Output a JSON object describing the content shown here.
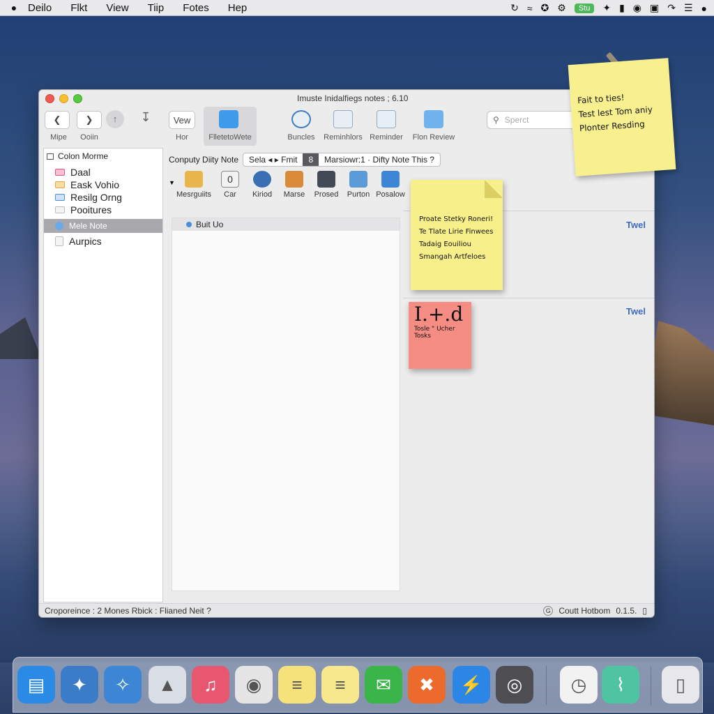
{
  "menubar": {
    "items": [
      "Deilo",
      "Flkt",
      "View",
      "Tiip",
      "Fotes",
      "Hep"
    ],
    "status_badge": "Stu",
    "status_icons": [
      "sync-icon",
      "wifi-icon",
      "satellite-icon",
      "gear-icon",
      "badge",
      "bluetooth-icon",
      "battery-icon",
      "settings-icon",
      "airplay-icon",
      "dnd-icon",
      "list-icon",
      "user-icon"
    ]
  },
  "window": {
    "title": "Imuste Inidalfiegs notes ; 6.10",
    "toolbar": {
      "back_label": "Mipe",
      "forward_label": "Ooiin",
      "view_button": "Vew",
      "view_label": "Hor",
      "file_label": "FlletetoWete",
      "bundles_label": "Buncles",
      "reminders_label": "Reminhlors",
      "reminder_label": "Reminder",
      "review_label": "Flon Review",
      "search_placeholder": "Sperct"
    },
    "sidebar": {
      "header": "Colon Morme",
      "items": [
        {
          "label": "Daal",
          "color": "#e04f7f"
        },
        {
          "label": "Eask Vohio",
          "color": "#e2a63a"
        },
        {
          "label": "Resilg Orng",
          "color": "#4c8fd9"
        },
        {
          "label": "Pooitures",
          "color": "#cccccc"
        },
        {
          "label": "Mele Note",
          "color": "#4c8fd9"
        },
        {
          "label": "Aurpics",
          "color": "#cccccc"
        }
      ]
    },
    "content": {
      "breadcrumb": "Conputy Diity Note",
      "segments": [
        "Sela ◂ ▸ Fmit",
        "8",
        "Marsiowr:1 · Difty Note This ?"
      ],
      "icons": [
        {
          "label": "Mesrguiits",
          "color": "#e8b64a"
        },
        {
          "label": "Car",
          "color": "#f2f2f2"
        },
        {
          "label": "Kiriod",
          "color": "#3a6fb3"
        },
        {
          "label": "Marse",
          "color": "#d98b3a"
        },
        {
          "label": "Prosed",
          "color": "#444a55"
        },
        {
          "label": "Purton",
          "color": "#5a9bd8"
        },
        {
          "label": "Posalow",
          "color": "#3d86d6"
        }
      ],
      "list_row": "Buit Uo",
      "twel_1": "Twel",
      "twel_2": "Twel"
    },
    "statusbar": {
      "left": "Croporeince : 2 Mones Rbick : Flianed Neit ?",
      "right_text": "Coutt Hotbom",
      "right_value": "0.1.5."
    }
  },
  "stickies": {
    "note1": [
      "Fait to ties!",
      "Test lest Tom aniy",
      "Plonter Resding"
    ],
    "note2": [
      "Proate Stetky Roneri!",
      "Te Tlate Lirie Finwees",
      "Tadaig Eouiliou",
      "Smangah Artfeloes"
    ],
    "note3_big": "I.+.d",
    "note3": [
      "Tosle \" Ucher",
      "Tosks"
    ]
  },
  "dock": {
    "icons": [
      {
        "name": "finder-icon",
        "glyph": "▤",
        "color": "#2a8ae6"
      },
      {
        "name": "safari-icon",
        "glyph": "✦",
        "color": "#3b7cc8"
      },
      {
        "name": "compass-icon",
        "glyph": "✧",
        "color": "#3d86d6"
      },
      {
        "name": "drive-icon",
        "glyph": "▲",
        "color": "#d8dde6"
      },
      {
        "name": "music-icon",
        "glyph": "♫",
        "color": "#e8576f"
      },
      {
        "name": "chrome-icon",
        "glyph": "◉",
        "color": "#e5e5e5"
      },
      {
        "name": "notes-icon",
        "glyph": "≡",
        "color": "#f5e27a"
      },
      {
        "name": "stickies-icon",
        "glyph": "≡",
        "color": "#f7e88e"
      },
      {
        "name": "messages-icon",
        "glyph": "✉",
        "color": "#3ab54a"
      },
      {
        "name": "tools-icon",
        "glyph": "✖",
        "color": "#ec6a2b"
      },
      {
        "name": "messenger-icon",
        "glyph": "⚡",
        "color": "#2c86e6"
      },
      {
        "name": "camera-icon",
        "glyph": "◎",
        "color": "#4d4d52"
      },
      {
        "name": "clock-icon",
        "glyph": "◷",
        "color": "#f2f2f2"
      },
      {
        "name": "preview-icon",
        "glyph": "⌇",
        "color": "#4fc4a2"
      },
      {
        "name": "trash-icon",
        "glyph": "▯",
        "color": "#e8e8ec"
      }
    ]
  }
}
